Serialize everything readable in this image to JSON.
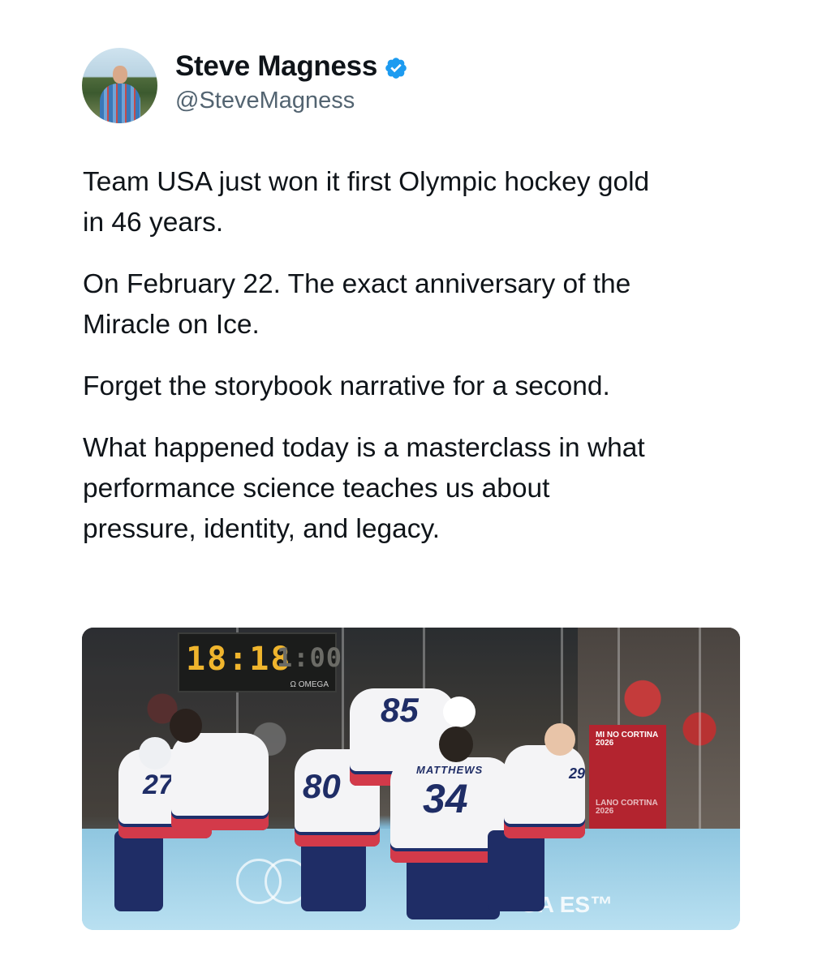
{
  "author": {
    "display_name": "Steve Magness",
    "handle": "@SteveMagness",
    "verified": true,
    "verified_icon": "verified-badge-icon",
    "accent_color": "#1d9bf0"
  },
  "tweet": {
    "paragraphs": [
      "Team USA just won it first Olympic hockey gold\nin 46 years.",
      "On February 22. The exact anniversary of the\nMiracle on Ice.",
      "Forget the storybook narrative for a second.",
      "What happened today is a masterclass in what\nperformance science teaches us about\npressure, identity, and legacy."
    ]
  },
  "media": {
    "scoreboard_time": "18:18",
    "scoreboard_time_2": "1:00",
    "scoreboard_brand": "Ω OMEGA",
    "jersey_numbers": [
      "85",
      "34",
      "29",
      "80",
      "27"
    ],
    "jersey_name": "MATTHEWS",
    "banner_text": "MI  NO CORTINA\n2026",
    "banner_text_2": "LANO CORTINA\n2026",
    "rink_text": "PI\nGA  ES™"
  }
}
